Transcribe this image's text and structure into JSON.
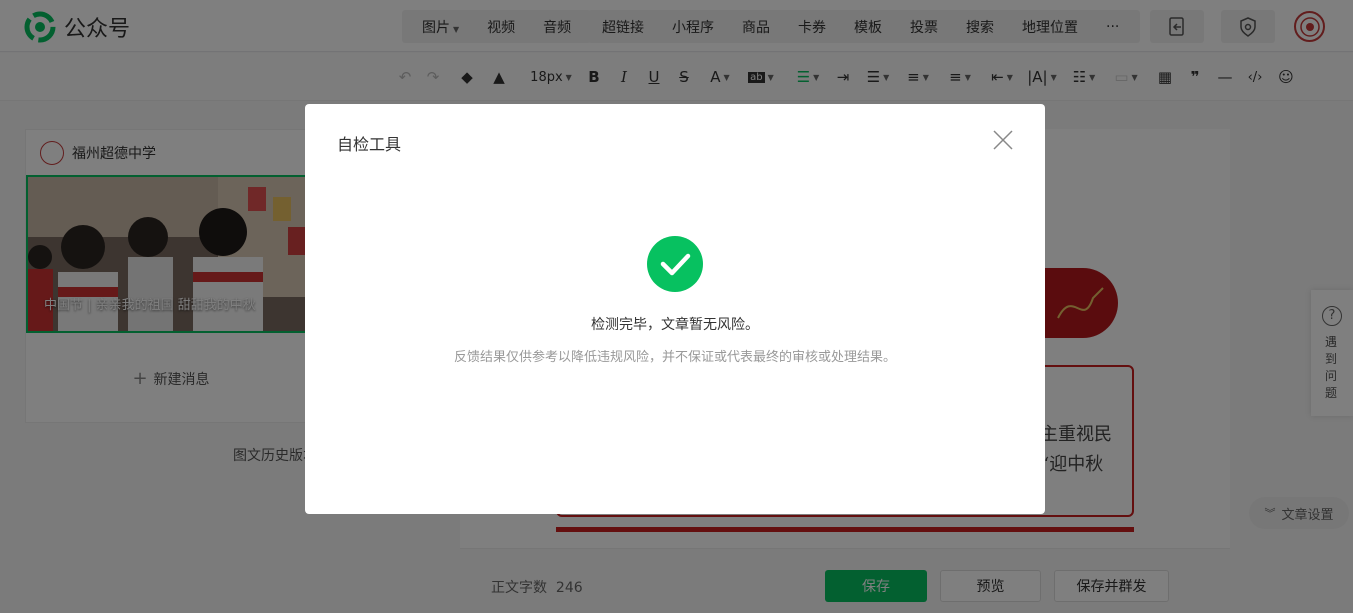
{
  "app": {
    "title": "公众号",
    "accent": "#07c160"
  },
  "topbar": {
    "media": [
      {
        "label": "图片",
        "dropdown": true
      },
      {
        "label": "视频"
      },
      {
        "label": "音频"
      }
    ],
    "insert": [
      "超链接",
      "小程序",
      "商品",
      "卡券",
      "模板",
      "投票",
      "搜索",
      "地理位置",
      "···"
    ],
    "icons": [
      "document-export-icon",
      "shield-icon",
      "avatar"
    ]
  },
  "format_toolbar": {
    "font_size": "18px",
    "tools": [
      "undo-icon",
      "redo-icon",
      "format-painter-icon",
      "clear-format-icon",
      "bold-icon",
      "italic-icon",
      "underline-icon",
      "strikethrough-icon",
      "font-color-icon",
      "background-color-icon",
      "align-icon",
      "indent-icon",
      "line-height-icon",
      "paragraph-spacing-icon",
      "list-icon",
      "table-icon",
      "quote-icon",
      "divider-icon",
      "code-icon",
      "emoji-icon"
    ]
  },
  "left_panel": {
    "account_name": "福州超德中学",
    "cover_title": "中国节 | 亲亲我的祖国 甜甜我的中秋",
    "new_message": "新建消息",
    "history": "图文历史版本"
  },
  "editor": {
    "text_line1": "主重视民",
    "text_line2": "“迎中秋"
  },
  "bottom_bar": {
    "word_count_label": "正文字数",
    "word_count": "246",
    "save": "保存",
    "preview": "预览",
    "save_publish": "保存并群发"
  },
  "right_float": {
    "help": "遇到问题",
    "article_settings": "文章设置"
  },
  "dialog": {
    "title": "自检工具",
    "message": "检测完毕，文章暂无风险。",
    "note": "反馈结果仅供参考以降低违规风险，并不保证或代表最终的审核或处理结果。"
  }
}
